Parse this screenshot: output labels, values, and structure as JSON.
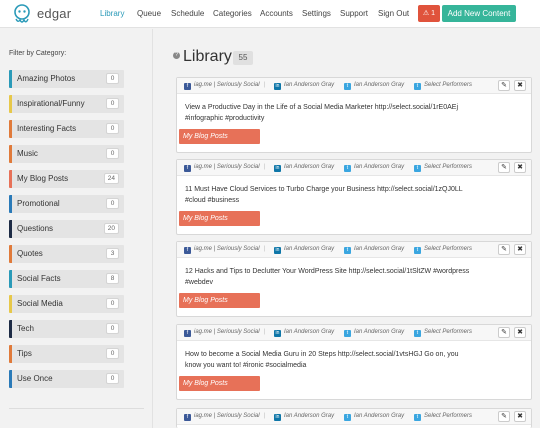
{
  "app": {
    "logo_text": "edgar"
  },
  "nav": {
    "library": "Library",
    "queue": "Queue",
    "schedule": "Schedule",
    "categories": "Categories",
    "accounts": "Accounts",
    "settings": "Settings",
    "support": "Support",
    "signout": "Sign Out"
  },
  "alert": {
    "count": "1",
    "color": "#e0533c"
  },
  "add_button": {
    "label": "Add New Content",
    "color": "#36b59a"
  },
  "sidebar": {
    "filter_label": "Filter by Category:",
    "categories": [
      {
        "name": "Amazing Photos",
        "count": "0",
        "color": "#2a9ab8"
      },
      {
        "name": "Inspirational/Funny",
        "count": "0",
        "color": "#e7c84a"
      },
      {
        "name": "Interesting Facts",
        "count": "0",
        "color": "#e07a3a"
      },
      {
        "name": "Music",
        "count": "0",
        "color": "#e07a3a"
      },
      {
        "name": "My Blog Posts",
        "count": "24",
        "color": "#e77158"
      },
      {
        "name": "Promotional",
        "count": "0",
        "color": "#2a7ab8"
      },
      {
        "name": "Questions",
        "count": "20",
        "color": "#1d2b45"
      },
      {
        "name": "Quotes",
        "count": "3",
        "color": "#e07a3a"
      },
      {
        "name": "Social Facts",
        "count": "8",
        "color": "#2a9ab8"
      },
      {
        "name": "Social Media",
        "count": "0",
        "color": "#e7c84a"
      },
      {
        "name": "Tech",
        "count": "0",
        "color": "#1d2b45"
      },
      {
        "name": "Tips",
        "count": "0",
        "color": "#e07a3a"
      },
      {
        "name": "Use Once",
        "count": "0",
        "color": "#2a7ab8"
      }
    ]
  },
  "main": {
    "title": "Library",
    "count": "55"
  },
  "accounts": {
    "a1": "iag.me | Seriously Social",
    "a2": "Ian Anderson Gray",
    "a3": "Ian Anderson Gray",
    "a4": "Select Performers"
  },
  "posts": [
    {
      "text": "View a Productive Day in the Life of a Social Media Marketer http://select.social/1rE0AEj #infographic #productivity",
      "category": "My Blog Posts"
    },
    {
      "text": "11 Must Have Cloud Services to Turbo Charge your Business http://select.social/1zQJ0LL #cloud #business",
      "category": "My Blog Posts"
    },
    {
      "text": "12 Hacks and Tips to Declutter Your WordPress Site http://select.social/1tSltZW #wordpress #webdev",
      "category": "My Blog Posts"
    },
    {
      "text": "How to become a Social Media Guru in 20 Steps http://select.social/1vtsHGJ Go on, you know you want to! #ironic #socialmedia",
      "category": "My Blog Posts"
    }
  ]
}
